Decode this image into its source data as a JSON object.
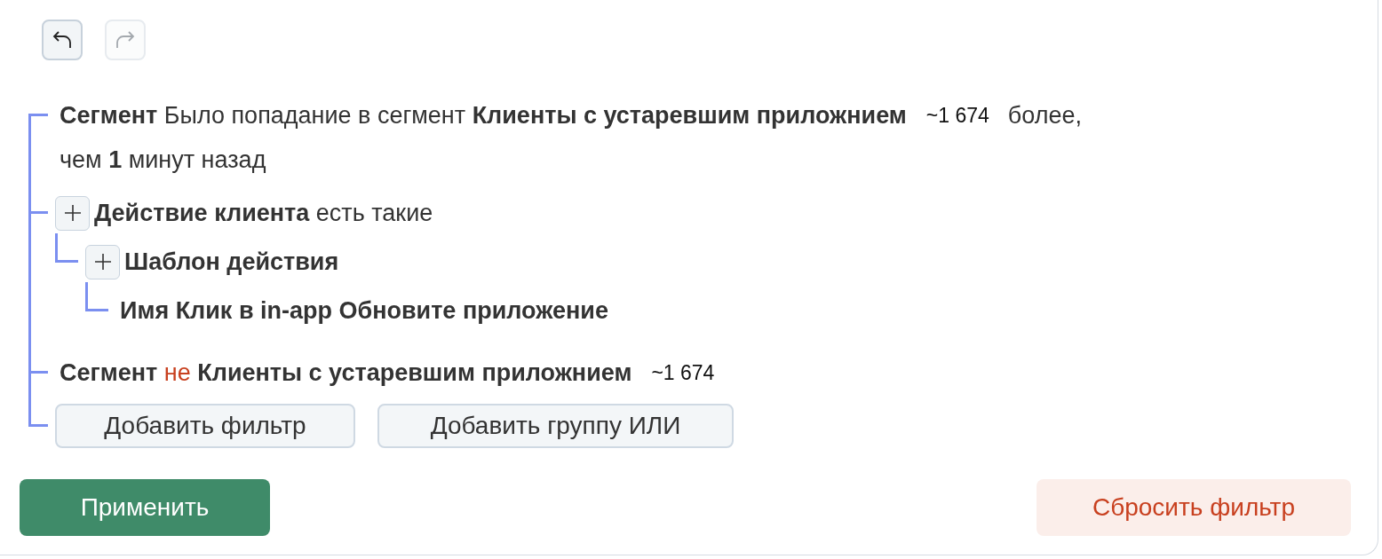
{
  "toolbar": {
    "undo": {
      "disabled": false
    },
    "redo": {
      "disabled": true
    }
  },
  "filters": [
    {
      "kind": "segment",
      "label": "Сегмент",
      "condition": "Было попадание в сегмент",
      "negated": false,
      "value": "Клиенты с устаревшим приложнием",
      "count": "~1 674",
      "tail": [
        "более,",
        "чем **1** минут назад"
      ]
    },
    {
      "kind": "action",
      "label": "Действие клиента",
      "condition": "есть такие",
      "children": [
        {
          "kind": "template",
          "label": "Шаблон действия",
          "children": [
            {
              "kind": "property",
              "text": "Имя Клик в in-app Обновите приложение"
            }
          ]
        }
      ]
    },
    {
      "kind": "segment",
      "label": "Сегмент",
      "condition": "не",
      "negated": true,
      "value": "Клиенты с устаревшим приложнием",
      "count": "~1 674"
    }
  ],
  "add_buttons": [
    "Добавить фильтр",
    "Добавить группу ИЛИ"
  ],
  "apply_button": "Применить",
  "reset_button": "Сбросить фильтр"
}
